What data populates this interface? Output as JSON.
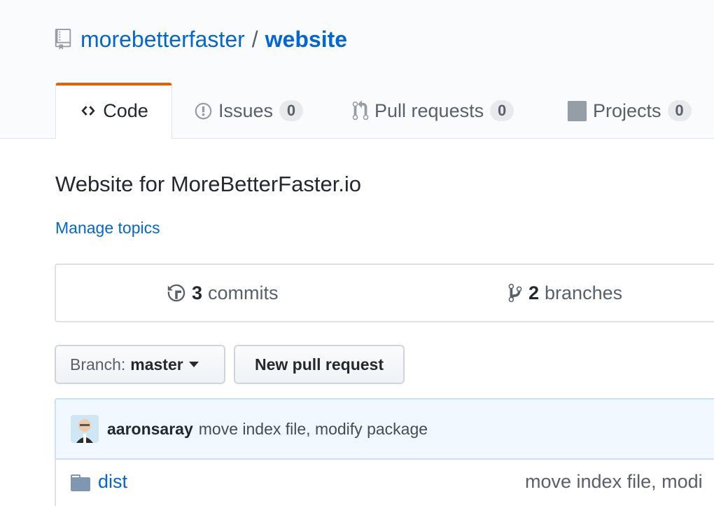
{
  "repo": {
    "owner": "morebetterfaster",
    "separator": "/",
    "name": "website"
  },
  "tabs": [
    {
      "label": "Code"
    },
    {
      "label": "Issues",
      "count": "0"
    },
    {
      "label": "Pull requests",
      "count": "0"
    },
    {
      "label": "Projects",
      "count": "0"
    }
  ],
  "description": "Website for MoreBetterFaster.io",
  "manage_topics": "Manage topics",
  "numbers": {
    "commits": {
      "count": "3",
      "label": "commits"
    },
    "branches": {
      "count": "2",
      "label": "branches"
    }
  },
  "branch_button": {
    "prefix": "Branch:",
    "value": "master"
  },
  "new_pr_button": "New pull request",
  "latest_commit": {
    "author": "aaronsaray",
    "message": "move index file, modify package"
  },
  "files": [
    {
      "name": "dist",
      "type": "folder",
      "message": "move index file, modi"
    }
  ],
  "colors": {
    "link": "#0366d6",
    "tab_accent": "#e36209",
    "commit_bg": "#f1f8ff"
  },
  "icons": [
    "repo-icon",
    "code-icon",
    "issue-icon",
    "pull-request-icon",
    "project-icon",
    "history-icon",
    "branch-icon",
    "caret-down-icon",
    "folder-icon"
  ]
}
